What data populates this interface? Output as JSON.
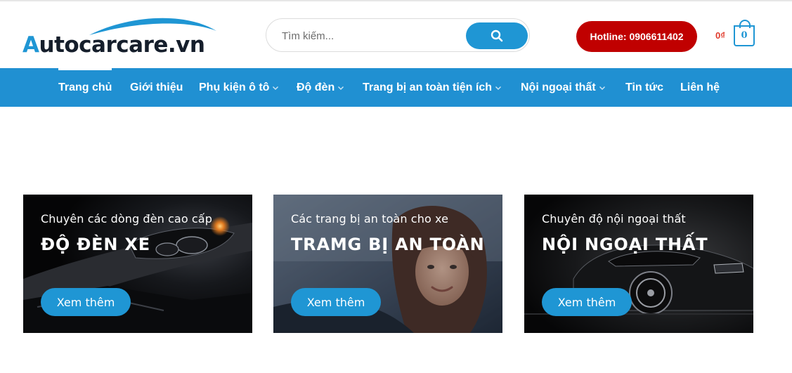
{
  "header": {
    "logo": {
      "first_letter": "A",
      "rest": "utocarcare.vn"
    },
    "search": {
      "placeholder": "Tìm kiếm..."
    },
    "hotline_label": "Hotline: 0906611402",
    "cart": {
      "total": "0₫",
      "count": "0"
    }
  },
  "nav": {
    "items": [
      {
        "label": "Trang chủ",
        "has_dropdown": false,
        "active": true
      },
      {
        "label": "Giới thiệu",
        "has_dropdown": false
      },
      {
        "label": "Phụ kiện ô tô",
        "has_dropdown": true
      },
      {
        "label": "Độ đèn",
        "has_dropdown": true
      },
      {
        "label": "Trang bị an toàn tiện ích",
        "has_dropdown": true
      },
      {
        "label": "Nội ngoại thất",
        "has_dropdown": true
      },
      {
        "label": "Tin tức",
        "has_dropdown": false
      },
      {
        "label": "Liên hệ",
        "has_dropdown": false
      }
    ]
  },
  "banners": [
    {
      "subtitle": "Chuyên các dòng đèn cao cấp",
      "title": "ĐỘ ĐÈN XE",
      "button": "Xem thêm"
    },
    {
      "subtitle": "Các trang bị an toàn cho xe",
      "title": "TRAMG BỊ AN TOÀN",
      "button": "Xem thêm"
    },
    {
      "subtitle": "Chuyên độ nội ngoại thất",
      "title": "NỘI NGOẠI THẤT",
      "button": "Xem thêm"
    }
  ],
  "colors": {
    "primary": "#1f96d4",
    "nav_bg": "#2090d2",
    "hotline": "#c00000",
    "logo_dark": "#151e2b"
  }
}
